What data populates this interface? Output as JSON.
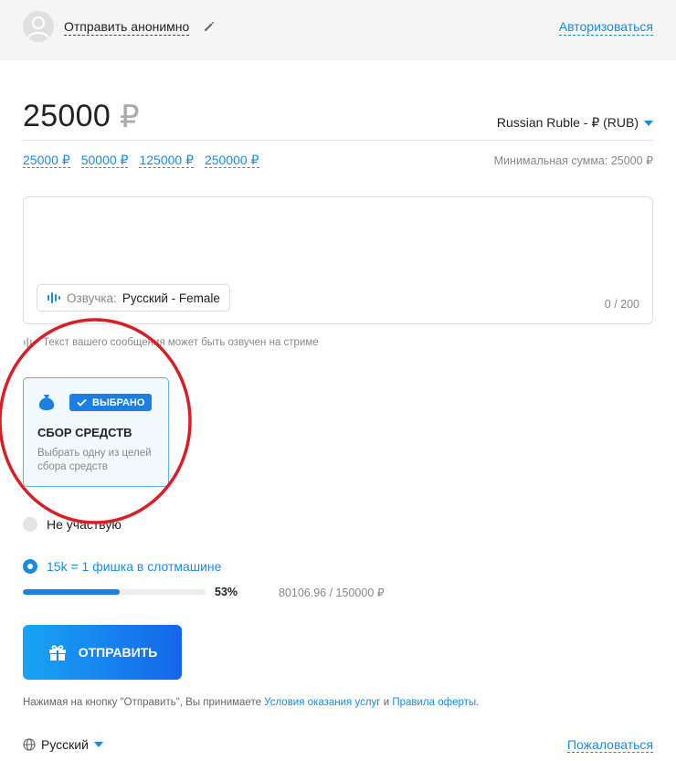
{
  "header": {
    "anon_label": "Отправить анонимно",
    "login_label": "Авторизоваться"
  },
  "amount": {
    "value": "25000",
    "symbol": "₽",
    "currency_selected": "Russian Ruble - ₽ (RUB)",
    "presets": [
      "25000 ₽",
      "50000 ₽",
      "125000 ₽",
      "250000 ₽"
    ],
    "min_label": "Минимальная сумма: 25000 ₽"
  },
  "message": {
    "placeholder": "",
    "voice_label": "Озвучка:",
    "voice_value": "Русский - Female",
    "counter": "0 / 200",
    "hint": "Текст вашего сообщения может быть озвучен на стриме"
  },
  "fundraising": {
    "badge": "ВЫБРАНО",
    "title": "СБОР СРЕДСТВ",
    "description": "Выбрать одну из целей сбора средств"
  },
  "goals": {
    "not_participating": "Не участвую",
    "selected_goal": "15k = 1 фишка в слотмашине",
    "progress_fraction": 0.53,
    "percent_label": "53%",
    "raised_label": "80106.96 / 150000 ₽"
  },
  "send_button": "ОТПРАВИТЬ",
  "terms": {
    "prefix": "Нажимая на кнопку \"Отправить\", Вы принимаете ",
    "link1": "Условия оказания услуг",
    "mid": " и ",
    "link2": "Правила оферты",
    "suffix": "."
  },
  "footer": {
    "language": "Русский",
    "complain": "Пожаловаться"
  },
  "colors": {
    "accent": "#1a8be0",
    "button_gradient_start": "#18a4f5",
    "button_gradient_end": "#1566e8",
    "annotation": "#d81e26"
  }
}
